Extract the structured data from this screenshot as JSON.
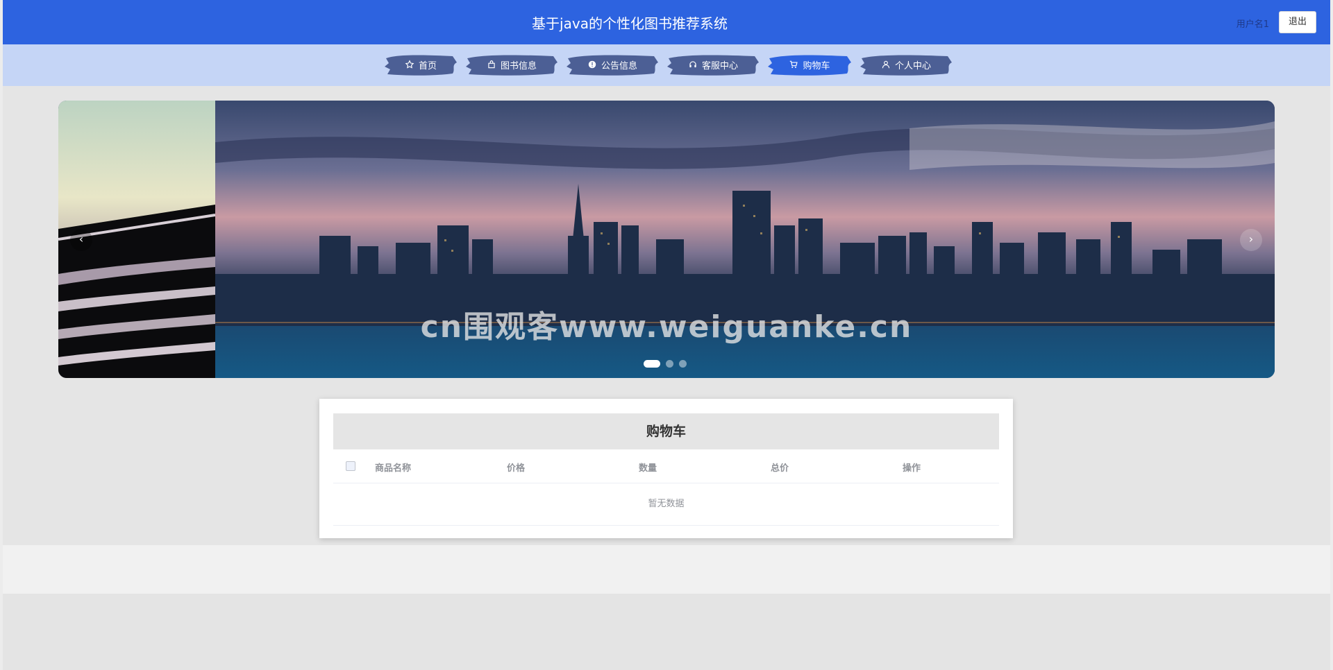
{
  "header": {
    "title": "基于java的个性化图书推荐系统",
    "user_name": "用户名1",
    "logout_label": "退出",
    "bg_color": "#2d63e0"
  },
  "nav": {
    "bg_color": "#c5d5f6",
    "items": [
      {
        "label": "首页",
        "icon": "star-icon"
      },
      {
        "label": "图书信息",
        "icon": "bag-icon"
      },
      {
        "label": "公告信息",
        "icon": "alert-circle-icon"
      },
      {
        "label": "客服中心",
        "icon": "headset-icon"
      },
      {
        "label": "购物车",
        "icon": "cart-icon",
        "active": true
      },
      {
        "label": "个人中心",
        "icon": "user-icon"
      }
    ],
    "active_color": "#2d63e0",
    "inactive_color": "#4c5f95"
  },
  "carousel": {
    "watermark": "cn围观客www.weiguanke.cn",
    "prev_label": "‹",
    "next_label": "›",
    "slide_count": 3,
    "active_index": 0
  },
  "cart": {
    "title": "购物车",
    "columns": [
      "商品名称",
      "价格",
      "数量",
      "总价",
      "操作"
    ],
    "empty_text": "暂无数据"
  }
}
